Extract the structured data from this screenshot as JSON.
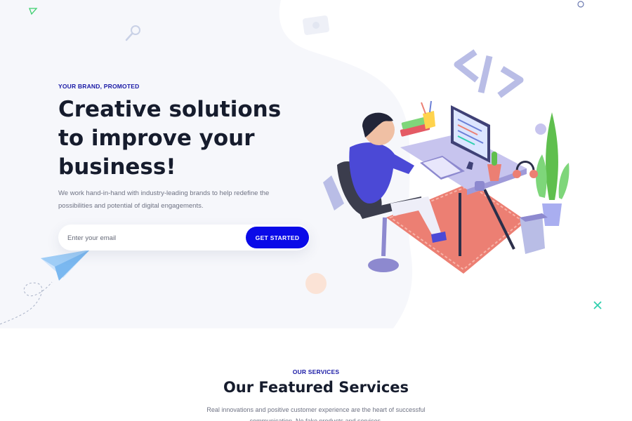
{
  "hero": {
    "kicker": "YOUR BRAND, PROMOTED",
    "title": "Creative solutions to improve your business!",
    "lead": "We work hand-in-hand with industry-leading brands to help redefine the possibilities and potential of digital engagements.",
    "subscribe": {
      "placeholder": "Enter your email",
      "button_label": "GET STARTED"
    }
  },
  "services": {
    "kicker": "OUR SERVICES",
    "title": "Our Featured Services",
    "lead": "Real innovations and positive customer experience are the heart of successful communication. No fake products and services."
  },
  "colors": {
    "accent": "#0a0ae8",
    "heading": "#161c2d",
    "kicker": "#1a1aa6"
  },
  "icons": [
    "paper-plane-icon",
    "magnifier-icon",
    "triangle-icon",
    "circle-icon",
    "close-x-icon",
    "code-brackets-icon",
    "workspace-illustration"
  ]
}
